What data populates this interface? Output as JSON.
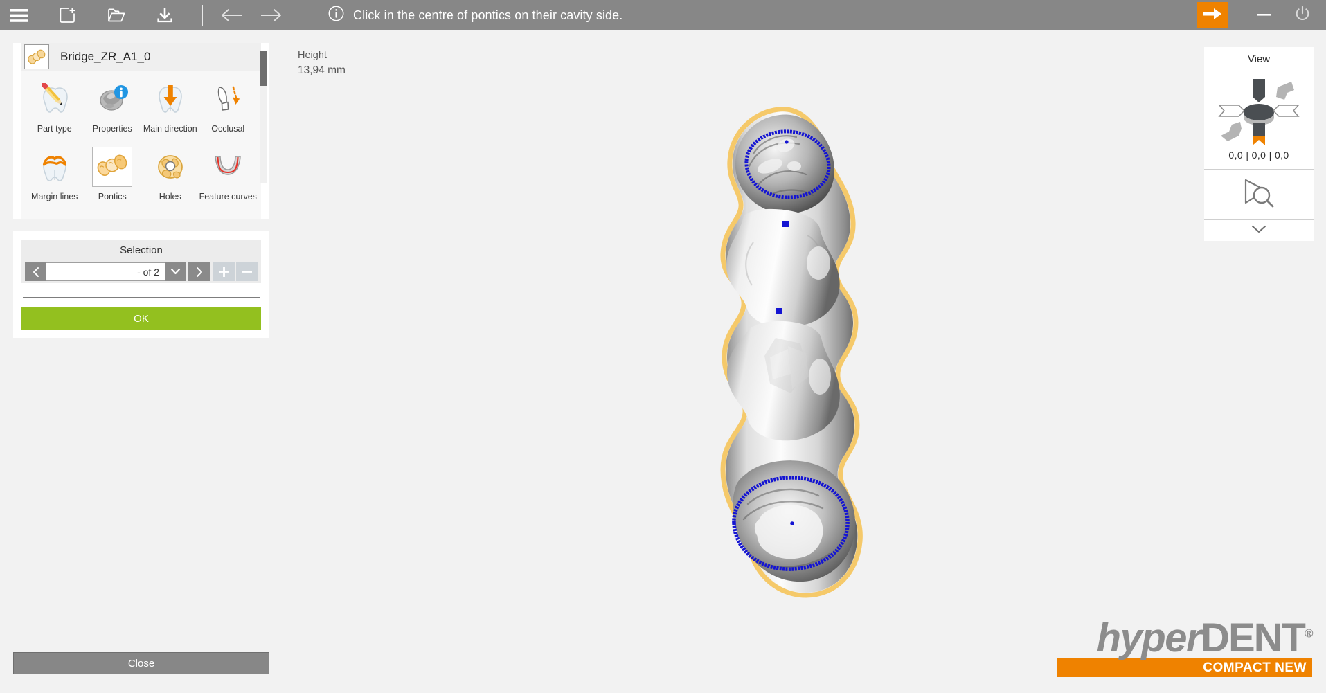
{
  "topbar": {
    "buttons": [
      {
        "name": "hamburger-menu-icon",
        "label": "Menu"
      },
      {
        "name": "new-project-icon",
        "label": "New"
      },
      {
        "name": "open-folder-icon",
        "label": "Open"
      },
      {
        "name": "save-download-icon",
        "label": "Save"
      }
    ],
    "nav": [
      {
        "name": "back-arrow-icon",
        "label": "Back"
      },
      {
        "name": "forward-arrow-icon",
        "label": "Forward"
      }
    ],
    "info_icon": "info-circle-icon",
    "message": "Click in the centre of pontics on their cavity side.",
    "right": [
      {
        "name": "next-step-arrow-icon",
        "label": "Next"
      },
      {
        "name": "minimize-icon",
        "label": "Minimize"
      },
      {
        "name": "power-icon",
        "label": "Exit"
      }
    ],
    "accent_color": "#ef8200",
    "background_color": "#878787"
  },
  "part_panel": {
    "thumbnail_icon": "bridge-part-icon",
    "part_name": "Bridge_ZR_A1_0",
    "tools": [
      {
        "label": "Part type",
        "icon": "tooth-pencil-icon",
        "selected": false,
        "badge": null
      },
      {
        "label": "Properties",
        "icon": "tooth-properties-icon",
        "selected": false,
        "badge": "info"
      },
      {
        "label": "Main direction",
        "icon": "tooth-down-arrow-icon",
        "selected": false,
        "badge": null
      },
      {
        "label": "Occlusal",
        "icon": "abutment-arrow-icon",
        "selected": false,
        "badge": null
      },
      {
        "label": "Margin lines",
        "icon": "tooth-margin-icon",
        "selected": false,
        "badge": null
      },
      {
        "label": "Pontics",
        "icon": "pontics-bridge-icon",
        "selected": true,
        "badge": null
      },
      {
        "label": "Holes",
        "icon": "tooth-hole-icon",
        "selected": false,
        "badge": null
      },
      {
        "label": "Feature curves",
        "icon": "feature-curves-icon",
        "selected": false,
        "badge": null
      }
    ]
  },
  "selection_panel": {
    "title": "Selection",
    "prev_label": "‹",
    "next_label": "›",
    "dropdown_label": "⌄",
    "add_label": "+",
    "remove_label": "−",
    "value": "- of 2",
    "placeholder": "- of 2",
    "ok_label": "OK",
    "ok_color": "#93c01f"
  },
  "close_button": {
    "label": "Close"
  },
  "viewport": {
    "height_label": "Height",
    "height_value": "13,94 mm",
    "model": {
      "name": "dental-bridge-model",
      "outline_color": "#f5c96a",
      "margin_curve_color": "#1414d2",
      "pontic_marker_color": "#1414d2",
      "markers": 4
    }
  },
  "view_panel": {
    "title": "View",
    "cube_icon": "view-orientation-cube-icon",
    "coordinates": "0,0  |  0,0 |  0,0",
    "zoom_icon": "zoom-to-fit-icon",
    "expand_icon": "chevron-down-icon"
  },
  "logo": {
    "text_light": "hyper",
    "text_bold": "DENT",
    "registered": "®",
    "tagline": "COMPACT NEW",
    "bar_color": "#ef8200",
    "text_color": "#8c8c8c"
  }
}
